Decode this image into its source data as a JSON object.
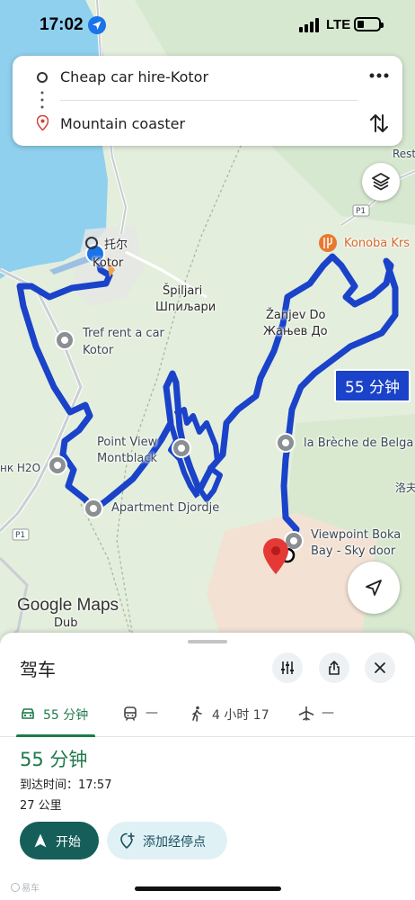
{
  "status_bar": {
    "time": "17:02",
    "network": "LTE"
  },
  "route": {
    "origin": "Cheap car hire-Kotor",
    "destination": "Mountain coaster"
  },
  "map": {
    "labels": {
      "kotor_cn": "托尔",
      "kotor": "Kotor",
      "konoba": "Konoba Krs",
      "spiljari": "Špiljari",
      "spiljari_cyr": "Шпиљари",
      "zanjev": "Žanjev Do",
      "zanjev_cyr": "Жањев До",
      "tref": "Tref rent a car",
      "tref2": "Kotor",
      "point_view": "Point View",
      "point_view2": "Montblack",
      "h2o": "нк H2O",
      "apartment": "Apartment Djordje",
      "breche": "la Brèche de Belga",
      "viewpoint": "Viewpoint Boka",
      "viewpoint2": "Bay - Sky door",
      "dub": "Dub",
      "rest": "Rest",
      "cn_edge": "洛夫",
      "road_p1a": "P1",
      "road_p1b": "P1"
    },
    "route_duration": "55 分钟",
    "google_logo": "Google Maps",
    "route_color": "#1a43c9"
  },
  "sheet": {
    "title": "驾车",
    "tabs": [
      {
        "label": "55 分钟"
      },
      {
        "label": "—"
      },
      {
        "label": "4 小时 17"
      },
      {
        "label": "—"
      }
    ],
    "duration": "55 分钟",
    "arrival": "到达时间：17:57",
    "distance": "27 公里",
    "start_label": "开始",
    "add_stop_label": "添加经停点"
  },
  "watermark": "易车"
}
